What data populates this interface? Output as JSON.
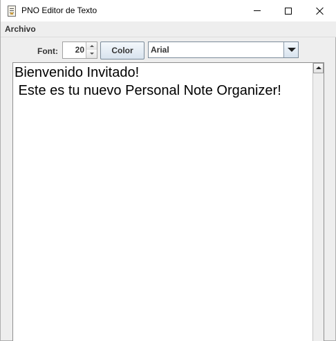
{
  "window": {
    "title": "PNO Editor de Texto",
    "icon": "notepad-icon"
  },
  "menu": {
    "items": [
      "Archivo"
    ]
  },
  "toolbar": {
    "font_label": "Font:",
    "font_size": "20",
    "color_button": "Color",
    "font_family": "Arial"
  },
  "editor": {
    "text": "Bienvenido Invitado!\n Este es tu nuevo Personal Note Organizer!"
  }
}
